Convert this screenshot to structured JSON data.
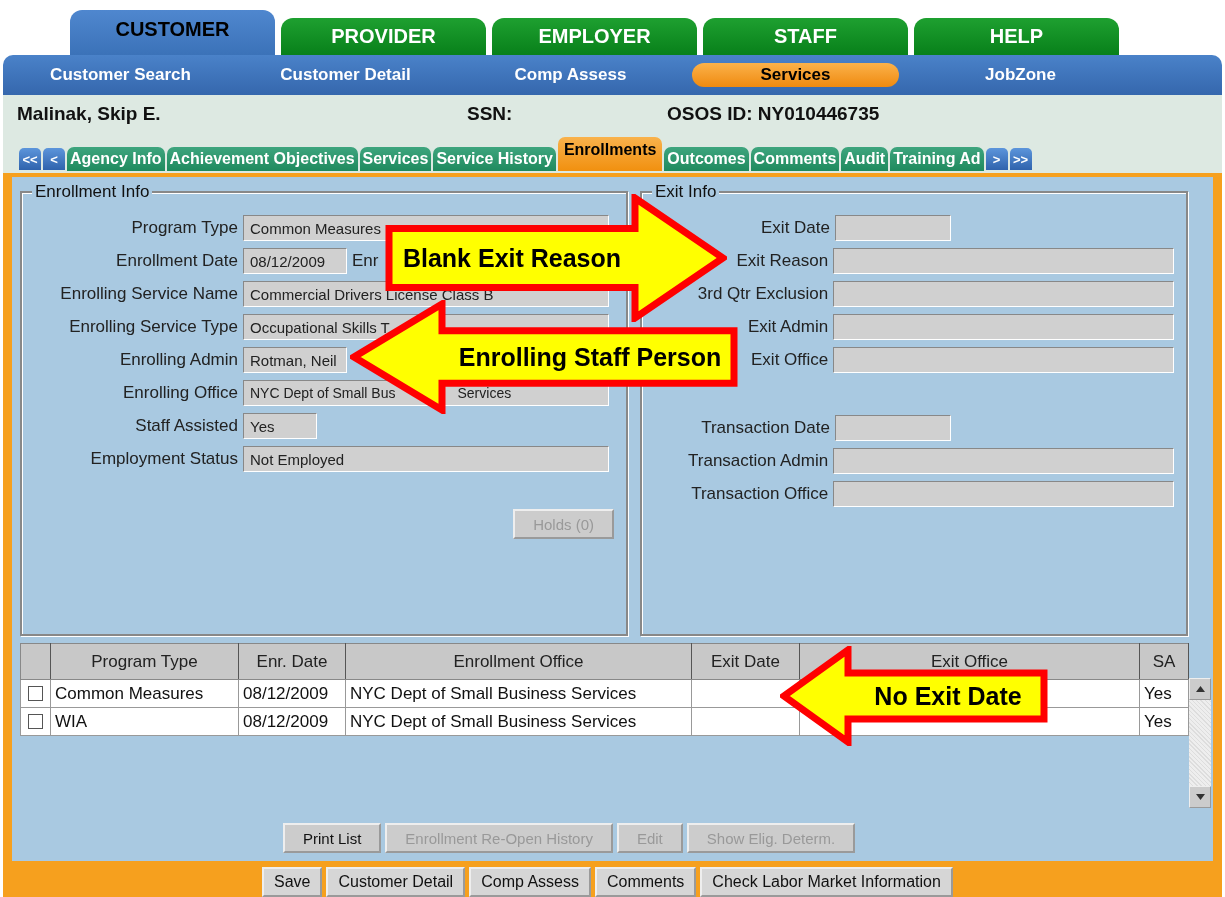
{
  "main_tabs": [
    {
      "label": "CUSTOMER",
      "selected": true
    },
    {
      "label": "PROVIDER",
      "selected": false
    },
    {
      "label": "EMPLOYER",
      "selected": false
    },
    {
      "label": "STAFF",
      "selected": false
    },
    {
      "label": "HELP",
      "selected": false
    }
  ],
  "nav": [
    {
      "label": "Customer Search",
      "selected": false
    },
    {
      "label": "Customer Detail",
      "selected": false
    },
    {
      "label": "Comp Assess",
      "selected": false
    },
    {
      "label": "Services",
      "selected": true
    },
    {
      "label": "JobZone",
      "selected": false
    }
  ],
  "customer": {
    "name": "Malinak, Skip E.",
    "ssn_label": "SSN:",
    "osos_id": "OSOS ID: NY010446735"
  },
  "scroll_left": [
    "<<",
    "<"
  ],
  "sub_tabs": [
    {
      "label": "Agency Info",
      "selected": false
    },
    {
      "label": "Achievement Objectives",
      "selected": false
    },
    {
      "label": "Services",
      "selected": false
    },
    {
      "label": "Service History",
      "selected": false
    },
    {
      "label": "Enrollments",
      "selected": true
    },
    {
      "label": "Outcomes",
      "selected": false
    },
    {
      "label": "Comments",
      "selected": false
    },
    {
      "label": "Audit",
      "selected": false
    },
    {
      "label": "Training Ad",
      "selected": false
    }
  ],
  "scroll_right": [
    ">",
    ">>"
  ],
  "enrollment_info": {
    "title": "Enrollment Info",
    "fields": [
      {
        "label": "Program Type",
        "value": "Common Measures",
        "kind": "wide"
      },
      {
        "label": "Enrollment Date",
        "value": "08/12/2009",
        "kind": "date",
        "suffix": "Enr"
      },
      {
        "label": "Enrolling Service Name",
        "value": "Commercial Drivers License Class B",
        "kind": "wide"
      },
      {
        "label": "Enrolling Service Type",
        "value": "Occupational Skills T",
        "kind": "wide"
      },
      {
        "label": "Enrolling Admin",
        "value": "Rotman, Neil",
        "kind": "cut"
      },
      {
        "label": "Enrolling Office",
        "value_parts": [
          "NYC Dept of Small Bus",
          "Services"
        ],
        "kind": "wide"
      },
      {
        "label": "Staff Assisted",
        "value": "Yes",
        "kind": "short"
      },
      {
        "label": "Employment Status",
        "value": "Not Employed",
        "kind": "wide"
      }
    ],
    "holds_button": {
      "label": "Holds (0)",
      "disabled": true
    }
  },
  "exit_info": {
    "title": "Exit Info",
    "groups": [
      [
        {
          "label": "Exit Date",
          "kind": "date"
        },
        {
          "label": "Exit Reason",
          "kind": "wide"
        },
        {
          "label": "3rd Qtr Exclusion",
          "kind": "wide"
        },
        {
          "label": "Exit Admin",
          "kind": "wide"
        },
        {
          "label": "Exit Office",
          "kind": "wide"
        }
      ],
      [
        {
          "label": "Transaction Date",
          "kind": "date"
        },
        {
          "label": "Transaction Admin",
          "kind": "wide"
        },
        {
          "label": "Transaction Office",
          "kind": "wide"
        }
      ]
    ]
  },
  "table": {
    "columns": [
      "Program Type",
      "Enr. Date",
      "Enrollment Office",
      "Exit Date",
      "Exit Office",
      "SA"
    ],
    "rows": [
      {
        "checked": false,
        "cells": [
          "Common Measures",
          "08/12/2009",
          "NYC Dept of Small Business Services",
          "",
          "",
          "Yes"
        ]
      },
      {
        "checked": false,
        "cells": [
          "WIA",
          "08/12/2009",
          "NYC Dept of Small Business Services",
          "",
          "",
          "Yes"
        ]
      }
    ]
  },
  "list_buttons": [
    {
      "label": "Print List",
      "disabled": false
    },
    {
      "label": "Enrollment Re-Open History",
      "disabled": true
    },
    {
      "label": "Edit",
      "disabled": true
    },
    {
      "label": "Show Elig. Determ.",
      "disabled": true
    }
  ],
  "footer_buttons": [
    {
      "label": "Save"
    },
    {
      "label": "Customer Detail"
    },
    {
      "label": "Comp Assess"
    },
    {
      "label": "Comments"
    },
    {
      "label": "Check Labor Market Information"
    }
  ],
  "callouts": [
    {
      "text": "Blank Exit Reason",
      "kind": "right"
    },
    {
      "text": "Enrolling Staff Person",
      "kind": "left"
    },
    {
      "text": "No Exit Date",
      "kind": "left"
    }
  ]
}
